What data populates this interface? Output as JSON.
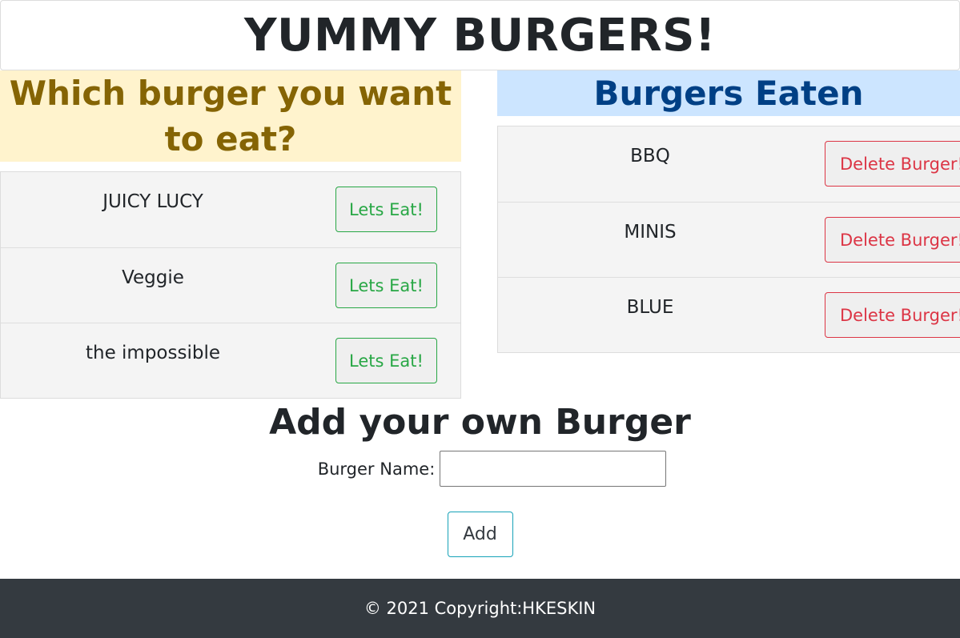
{
  "header": {
    "title": "YUMMY BURGERS!"
  },
  "left_panel": {
    "heading": "Which burger you want to eat?",
    "items": [
      {
        "name": "JUICY LUCY",
        "button_label": "Lets Eat!"
      },
      {
        "name": "Veggie",
        "button_label": "Lets Eat!"
      },
      {
        "name": "the impossible",
        "button_label": "Lets Eat!"
      }
    ]
  },
  "right_panel": {
    "heading": "Burgers Eaten",
    "items": [
      {
        "name": "BBQ",
        "button_label": "Delete Burger!"
      },
      {
        "name": "MINIS",
        "button_label": "Delete Burger!"
      },
      {
        "name": "BLUE",
        "button_label": "Delete Burger!"
      }
    ]
  },
  "add_form": {
    "heading": "Add your own Burger",
    "label": "Burger Name:",
    "input_value": "",
    "submit_label": "Add"
  },
  "footer": {
    "text": "© 2021 Copyright:HKESKIN"
  },
  "colors": {
    "eat_button": "#28a745",
    "delete_button": "#dc3545",
    "add_button_border": "#17a2b8",
    "warn_heading_bg": "#fff3cd",
    "info_heading_bg": "#cce5ff",
    "footer_bg": "#343a40"
  }
}
